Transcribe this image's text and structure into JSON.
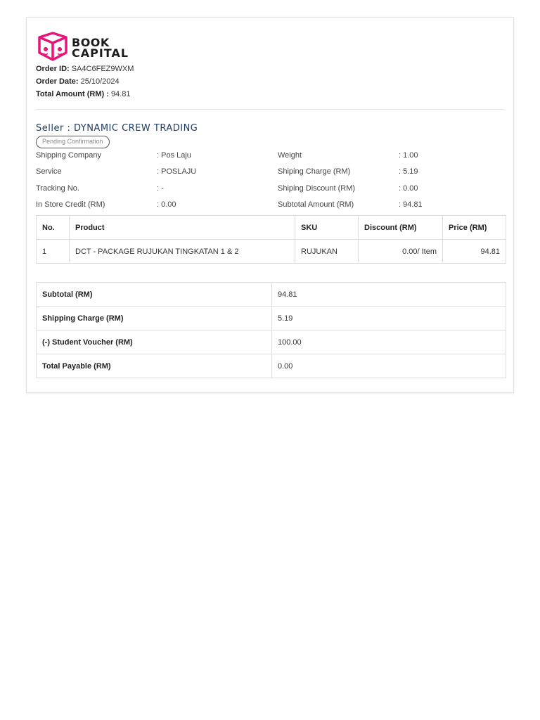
{
  "logo": {
    "line1": "BOOK",
    "line2": "CAPITAL",
    "brand_color": "#e5157a"
  },
  "order": {
    "id_label": "Order ID:",
    "id_value": "SA4C6FEZ9WXM",
    "date_label": "Order Date:",
    "date_value": "25/10/2024",
    "total_label": "Total Amount (RM) :",
    "total_value": "94.81"
  },
  "seller": {
    "label": "Seller : DYNAMIC CREW TRADING",
    "status": "Pending Confirmation"
  },
  "details_left": [
    {
      "label": "Shipping Company",
      "value": ": Pos Laju"
    },
    {
      "label": "Service",
      "value": ": POSLAJU"
    },
    {
      "label": "Tracking No.",
      "value": ": -"
    },
    {
      "label": "In Store Credit (RM)",
      "value": ": 0.00"
    }
  ],
  "details_right": [
    {
      "label": "Weight",
      "value": ": 1.00"
    },
    {
      "label": "Shiping Charge (RM)",
      "value": ": 5.19"
    },
    {
      "label": "Shiping Discount (RM)",
      "value": ": 0.00"
    },
    {
      "label": "Subtotal Amount (RM)",
      "value": ": 94.81"
    }
  ],
  "products": {
    "headers": [
      "No.",
      "Product",
      "SKU",
      "Discount (RM)",
      "Price (RM)"
    ],
    "rows": [
      {
        "no": "1",
        "product": "DCT - PACKAGE RUJUKAN TINGKATAN 1 & 2",
        "sku": "RUJUKAN",
        "discount": "0.00/ Item",
        "price": "94.81"
      }
    ]
  },
  "summary": [
    {
      "label": "Subtotal (RM)",
      "value": "94.81"
    },
    {
      "label": "Shipping Charge (RM)",
      "value": "5.19"
    },
    {
      "label": "(-) Student Voucher (RM)",
      "value": "100.00"
    },
    {
      "label": "Total Payable (RM)",
      "value": "0.00"
    }
  ]
}
